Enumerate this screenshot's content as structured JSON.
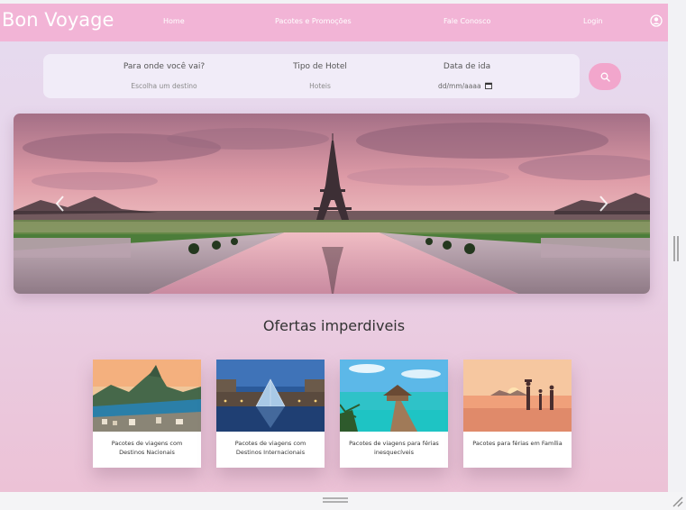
{
  "navbar": {
    "brand": "Bon Voyage",
    "links": [
      "Home",
      "Pacotes e Promoções",
      "Fale Conosco",
      "Login"
    ],
    "user_icon": "user-circle-icon"
  },
  "search": {
    "destination_label": "Para onde você vai?",
    "destination_placeholder": "Escolha um destino",
    "hotel_label": "Tipo de Hotel",
    "hotel_placeholder": "Hoteis",
    "date_label": "Data de ida",
    "date_placeholder": "dd/mm/aaaa",
    "search_icon": "search-icon"
  },
  "carousel": {
    "prev_icon": "chevron-left-icon",
    "next_icon": "chevron-right-icon"
  },
  "offers": {
    "title": "Ofertas imperdiveis",
    "cards": [
      {
        "caption": "Pacotes de viagens com Destinos Nacionais"
      },
      {
        "caption": "Pacotes de viagens com Destinos Internacionais"
      },
      {
        "caption": "Pacotes de viagens para férias inesquecíveis"
      },
      {
        "caption": "Pacotes para férias em Família"
      }
    ]
  },
  "colors": {
    "navbar": "#f2b4d6",
    "search_button": "#f2a6cc",
    "background_top": "#e6dcf0",
    "background_bottom": "#ecc2d6"
  }
}
